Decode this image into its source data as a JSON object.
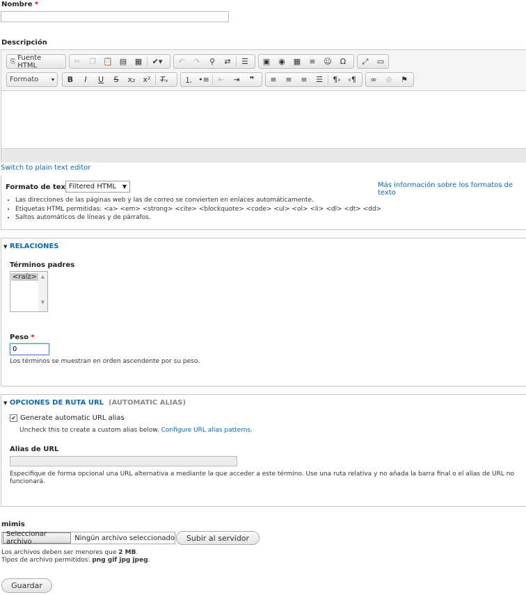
{
  "name_field": {
    "label": "Nombre",
    "required_mark": "*",
    "value": ""
  },
  "description": {
    "label": "Descripción"
  },
  "editor": {
    "source_button": "Fuente HTML",
    "format_dropdown": "Formato",
    "switch_link": "Switch to plain text editor"
  },
  "text_format": {
    "label": "Formato de texto",
    "selected": "Filtered HTML",
    "more_info_link": "Más información sobre los formatos de texto",
    "tips": [
      "Las direcciones de las páginas web y las de correo se convierten en enlaces automáticamente.",
      "Etiquetas HTML permitidas: <a> <em> <strong> <cite> <blockquote> <code> <ul> <ol> <li> <dl> <dt> <dd>",
      "Saltos automáticos de líneas y de párrafos."
    ]
  },
  "relations": {
    "legend": "RELACIONES",
    "parent_label": "Términos padres",
    "parent_option": "<raíz>",
    "weight_label": "Peso",
    "weight_required": "*",
    "weight_value": "0",
    "weight_desc": "Los términos se muestran en orden ascendente por su peso."
  },
  "url_options": {
    "legend": "OPCIONES DE RUTA URL",
    "legend_sub": "(AUTOMATIC ALIAS)",
    "checkbox_label": "Generate automatic URL alias",
    "checked": true,
    "hint_text": "Uncheck this to create a custom alias below.",
    "hint_link": "Configure URL alias patterns.",
    "alias_label": "Alias de URL",
    "alias_value": "",
    "alias_desc_1": "Especifique de forma opcional una URL alternativa a mediante la que acceder a este término. Use una ruta relativa y no añada la barra final o el alias de URL no",
    "alias_desc_2": "funcionará."
  },
  "upload": {
    "label": "mimis",
    "choose_button": "Seleccionar archivo",
    "no_file": "Ningún archivo seleccionado",
    "upload_button": "Subir al servidor",
    "size_prefix": "Los archivos deben ser menores que ",
    "size_value": "2 MB",
    "size_suffix": ".",
    "types_prefix": "Tipos de archivo permitidos: ",
    "types_value": "png gif jpg jpeg",
    "types_suffix": "."
  },
  "save_button": "Guardar",
  "colors": {
    "link": "#0b69a9",
    "required": "#e00000"
  }
}
